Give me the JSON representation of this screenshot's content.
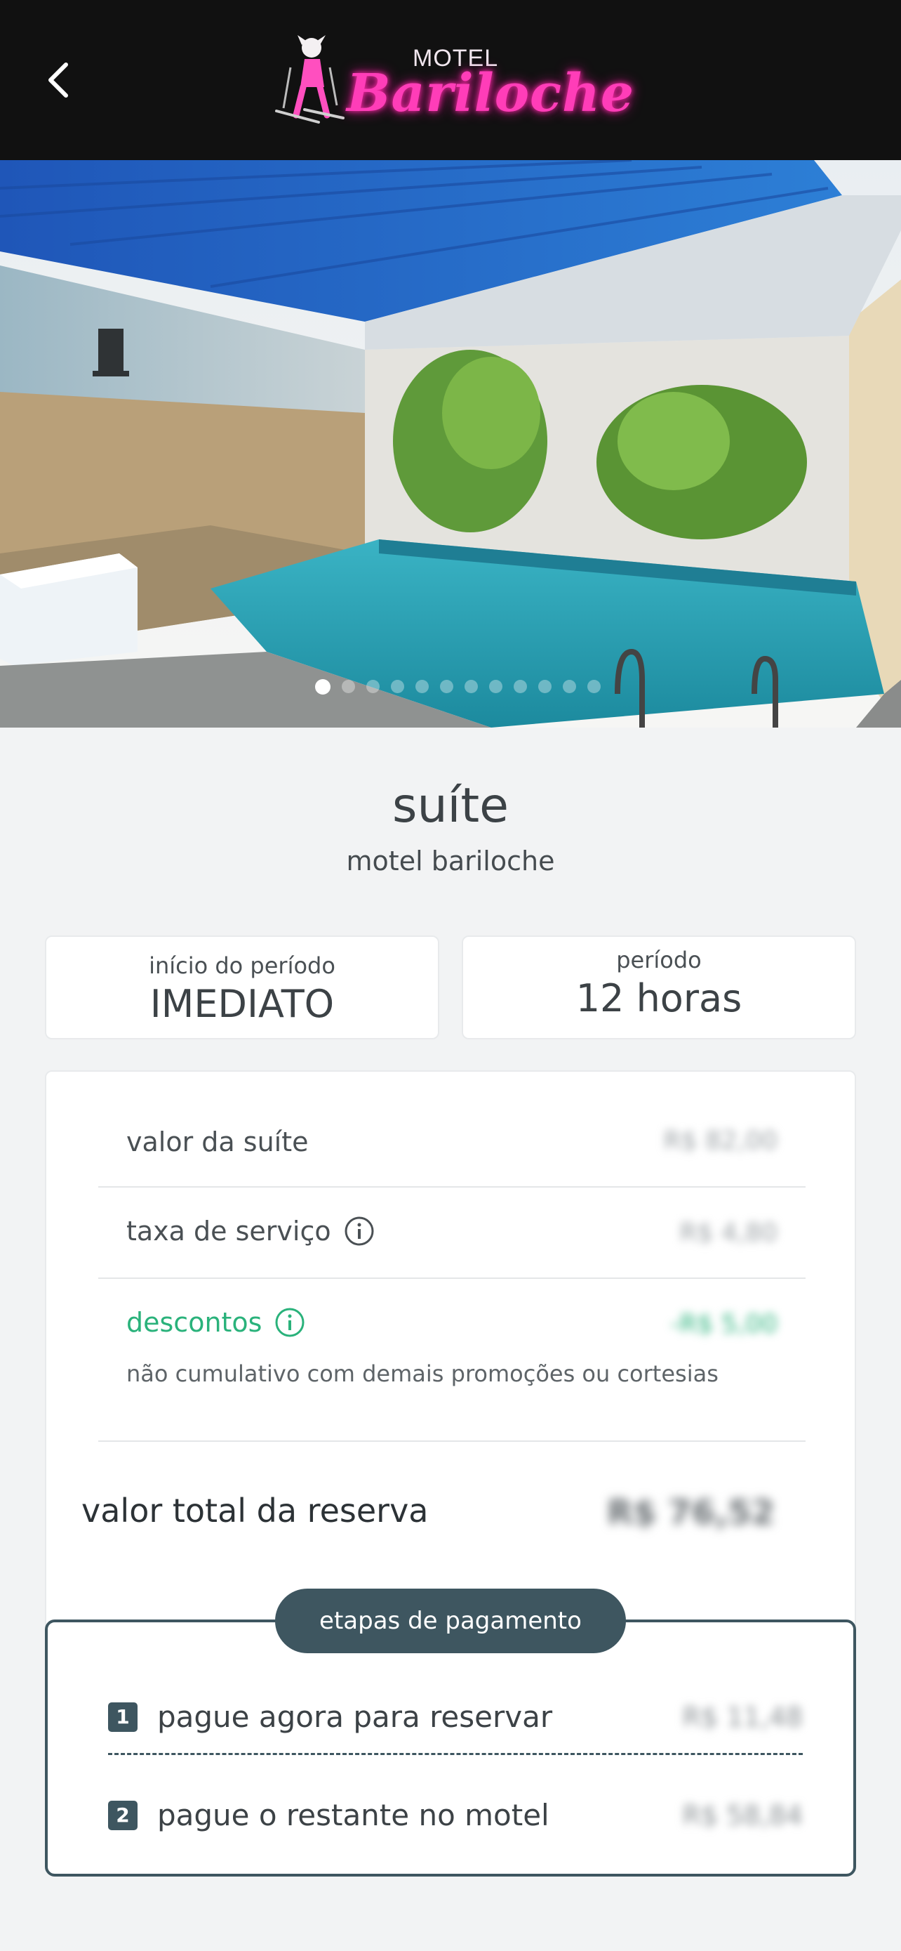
{
  "header": {
    "logo_small": "MOTEL",
    "logo_script": "Bariloche"
  },
  "carousel": {
    "active_index": 0,
    "count": 12
  },
  "suite": {
    "title": "suíte",
    "subtitle": "motel bariloche"
  },
  "period_start": {
    "label": "início do período",
    "value": "IMEDIATO"
  },
  "period": {
    "label": "período",
    "value": "12 horas"
  },
  "pricing": {
    "suite_value_label": "valor da suíte",
    "suite_value": "R$ 82,00",
    "service_fee_label": "taxa de serviço",
    "service_fee": "R$ 4,80",
    "discounts_label": "descontos",
    "discounts_value": "-R$ 5,00",
    "discounts_note": "não cumulativo com demais promoções ou cortesias",
    "total_label": "valor total da reserva",
    "total_value": "R$ 76,52"
  },
  "payment_steps": {
    "title": "etapas de pagamento",
    "steps": [
      {
        "number": "1",
        "label": "pague agora para reservar",
        "value": "R$ 11,48"
      },
      {
        "number": "2",
        "label": "pague o restante no motel",
        "value": "R$ 58,84"
      }
    ]
  },
  "colors": {
    "header_bg": "#111111",
    "accent_dark": "#3e5660",
    "discount_green": "#2ab27b",
    "logo_pink": "#ff3db8"
  }
}
